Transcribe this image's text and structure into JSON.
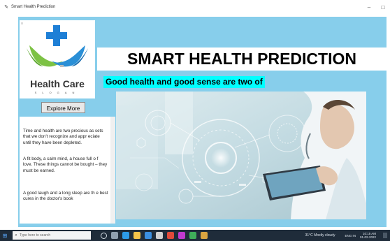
{
  "window": {
    "title": "Smart Health Prediction",
    "minimize_glyph": "–",
    "maximize_glyph": "□"
  },
  "logo": {
    "name": "Health Care",
    "slogan": "SLOGAN",
    "cross_color": "#1e7fd6",
    "hand_colors": [
      "#7dc244",
      "#2a8fd6"
    ]
  },
  "header": {
    "title": "SMART HEALTH PREDICTION"
  },
  "tagline": "Good health and good sense are two of",
  "explore_button": "Explore More !",
  "info_text": {
    "para1": "Time and health are two precious as sets that we don't recognize and appr eciate until they have been depleted.",
    "para2": "A fit body, a calm mind, a house full o f love. These things cannot be bought – they must be earned.",
    "para3": "A good laugh and a long sleep are th e best cures in the doctor's book"
  },
  "taskbar": {
    "search_placeholder": "Type here to search",
    "weather": "31°C  Mostly cloudy",
    "language": "ENG IN",
    "time": "10:15 AM",
    "date": "01-02-2022"
  },
  "colors": {
    "app_bg": "#87ceeb",
    "tagline_bg": "#00ffff",
    "taskbar_bg": "#1f2c3a"
  }
}
